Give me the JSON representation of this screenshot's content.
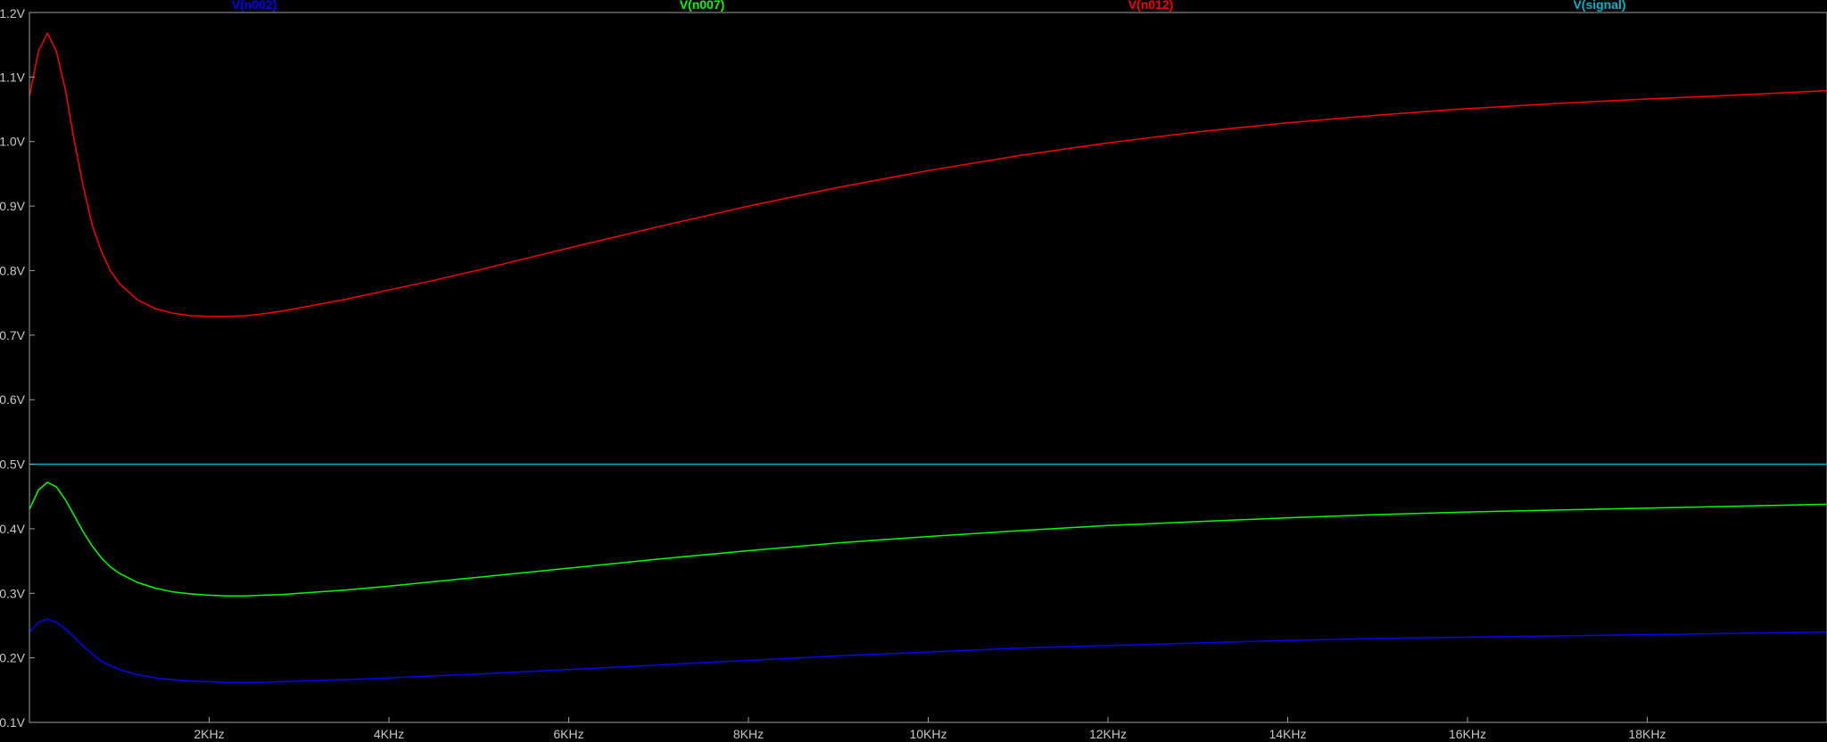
{
  "chart_data": {
    "type": "line",
    "title": "",
    "xlabel": "",
    "ylabel": "",
    "xlim": [
      0,
      20000
    ],
    "ylim": [
      0.1,
      1.2
    ],
    "grid": false,
    "legend_position": "top",
    "x_ticks": [
      {
        "value": 2000,
        "label": "2KHz"
      },
      {
        "value": 4000,
        "label": "4KHz"
      },
      {
        "value": 6000,
        "label": "6KHz"
      },
      {
        "value": 8000,
        "label": "8KHz"
      },
      {
        "value": 10000,
        "label": "10KHz"
      },
      {
        "value": 12000,
        "label": "12KHz"
      },
      {
        "value": 14000,
        "label": "14KHz"
      },
      {
        "value": 16000,
        "label": "16KHz"
      },
      {
        "value": 18000,
        "label": "18KHz"
      }
    ],
    "y_ticks": [
      {
        "value": 1.2,
        "label": "1.2V"
      },
      {
        "value": 1.1,
        "label": "1.1V"
      },
      {
        "value": 1.0,
        "label": "1.0V"
      },
      {
        "value": 0.9,
        "label": "0.9V"
      },
      {
        "value": 0.8,
        "label": "0.8V"
      },
      {
        "value": 0.7,
        "label": "0.7V"
      },
      {
        "value": 0.6,
        "label": "0.6V"
      },
      {
        "value": 0.5,
        "label": "0.5V"
      },
      {
        "value": 0.4,
        "label": "0.4V"
      },
      {
        "value": 0.3,
        "label": "0.3V"
      },
      {
        "value": 0.2,
        "label": "0.2V"
      },
      {
        "value": 0.1,
        "label": "0.1V"
      }
    ],
    "x": [
      0,
      100,
      200,
      300,
      400,
      500,
      600,
      700,
      800,
      900,
      1000,
      1200,
      1400,
      1600,
      1800,
      2000,
      2200,
      2400,
      2600,
      2800,
      3000,
      3500,
      4000,
      4500,
      5000,
      6000,
      7000,
      8000,
      9000,
      10000,
      11000,
      12000,
      13000,
      14000,
      15000,
      16000,
      17000,
      18000,
      19000,
      20000
    ],
    "series": [
      {
        "name": "V(n002)",
        "color": "#0000ff",
        "values": [
          0.24,
          0.255,
          0.26,
          0.255,
          0.245,
          0.232,
          0.218,
          0.206,
          0.195,
          0.188,
          0.182,
          0.174,
          0.169,
          0.166,
          0.164,
          0.163,
          0.162,
          0.162,
          0.162,
          0.163,
          0.164,
          0.166,
          0.169,
          0.172,
          0.175,
          0.182,
          0.189,
          0.196,
          0.203,
          0.209,
          0.215,
          0.219,
          0.223,
          0.227,
          0.23,
          0.232,
          0.234,
          0.236,
          0.238,
          0.24
        ]
      },
      {
        "name": "V(n007)",
        "color": "#00ff00",
        "values": [
          0.43,
          0.46,
          0.472,
          0.465,
          0.445,
          0.42,
          0.395,
          0.373,
          0.355,
          0.341,
          0.331,
          0.317,
          0.308,
          0.302,
          0.299,
          0.297,
          0.296,
          0.296,
          0.297,
          0.298,
          0.3,
          0.305,
          0.311,
          0.318,
          0.325,
          0.339,
          0.353,
          0.366,
          0.378,
          0.388,
          0.397,
          0.405,
          0.411,
          0.417,
          0.422,
          0.426,
          0.429,
          0.432,
          0.435,
          0.438
        ]
      },
      {
        "name": "V(n012)",
        "color": "#ff0000",
        "values": [
          1.07,
          1.14,
          1.168,
          1.14,
          1.08,
          1.0,
          0.93,
          0.87,
          0.83,
          0.8,
          0.78,
          0.755,
          0.741,
          0.734,
          0.73,
          0.729,
          0.729,
          0.73,
          0.733,
          0.737,
          0.742,
          0.755,
          0.77,
          0.785,
          0.801,
          0.835,
          0.868,
          0.9,
          0.929,
          0.955,
          0.978,
          0.998,
          1.015,
          1.029,
          1.041,
          1.051,
          1.059,
          1.066,
          1.072,
          1.079
        ]
      },
      {
        "name": "V(signal)",
        "color": "#00b4c8",
        "values": [
          0.5,
          0.5,
          0.5,
          0.5,
          0.5,
          0.5,
          0.5,
          0.5,
          0.5,
          0.5,
          0.5,
          0.5,
          0.5,
          0.5,
          0.5,
          0.5,
          0.5,
          0.5,
          0.5,
          0.5,
          0.5,
          0.5,
          0.5,
          0.5,
          0.5,
          0.5,
          0.5,
          0.5,
          0.5,
          0.5,
          0.5,
          0.5,
          0.5,
          0.5,
          0.5,
          0.5,
          0.5,
          0.5,
          0.5,
          0.5
        ]
      }
    ]
  },
  "legend": [
    {
      "label": "V(n002)",
      "color": "#0000ff"
    },
    {
      "label": "V(n007)",
      "color": "#00ff00"
    },
    {
      "label": "V(n012)",
      "color": "#ff0000"
    },
    {
      "label": "V(signal)",
      "color": "#00b4c8"
    }
  ]
}
